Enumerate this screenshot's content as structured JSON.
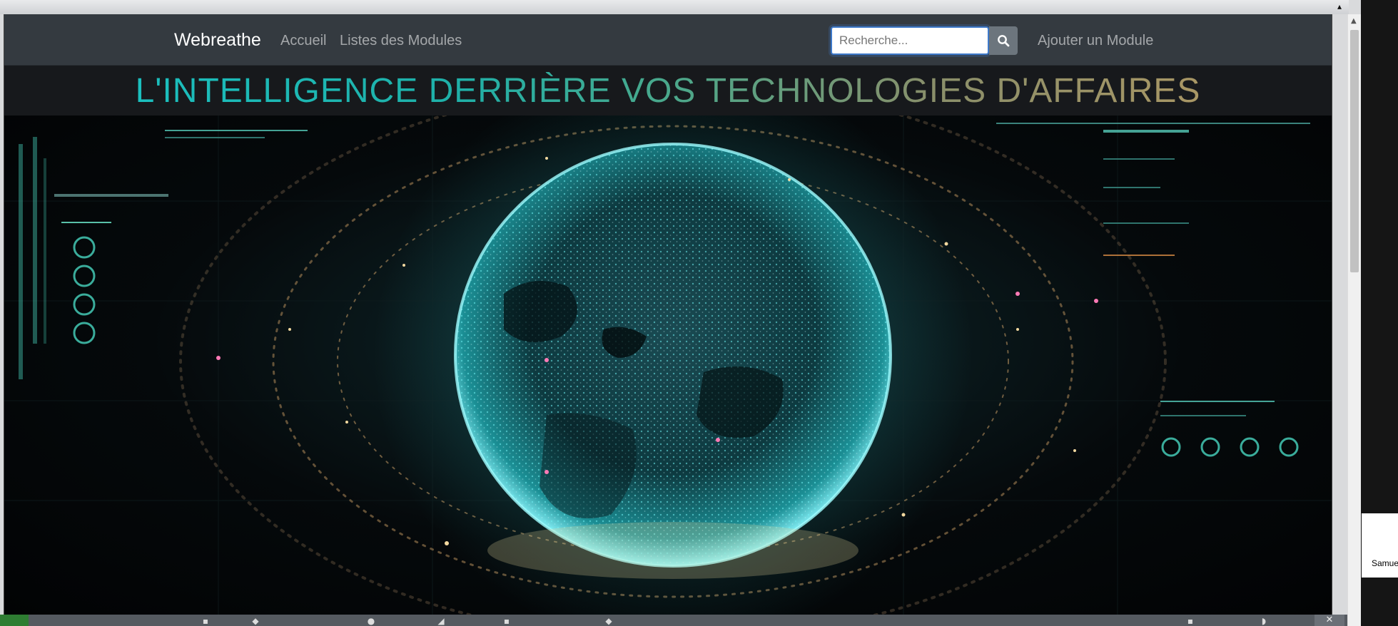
{
  "navbar": {
    "brand": "Webreathe",
    "links": [
      {
        "label": "Accueil"
      },
      {
        "label": "Listes des Modules"
      }
    ],
    "search": {
      "placeholder": "Recherche...",
      "value": ""
    },
    "add_module": "Ajouter un Module"
  },
  "hero": {
    "headline": "L'INTELLIGENCE DERRIÈRE VOS TECHNOLOGIES D'AFFAIRES",
    "headline_colors": [
      "#1bbfbe",
      "#4aa88b",
      "#a99765"
    ]
  },
  "side_panel": {
    "user_label": "Samue"
  },
  "colors": {
    "navbar_bg": "#343a40",
    "search_button_bg": "#6c757d",
    "accent_focus": "#3d78c9",
    "globe_cyan": "#37e0e6"
  }
}
